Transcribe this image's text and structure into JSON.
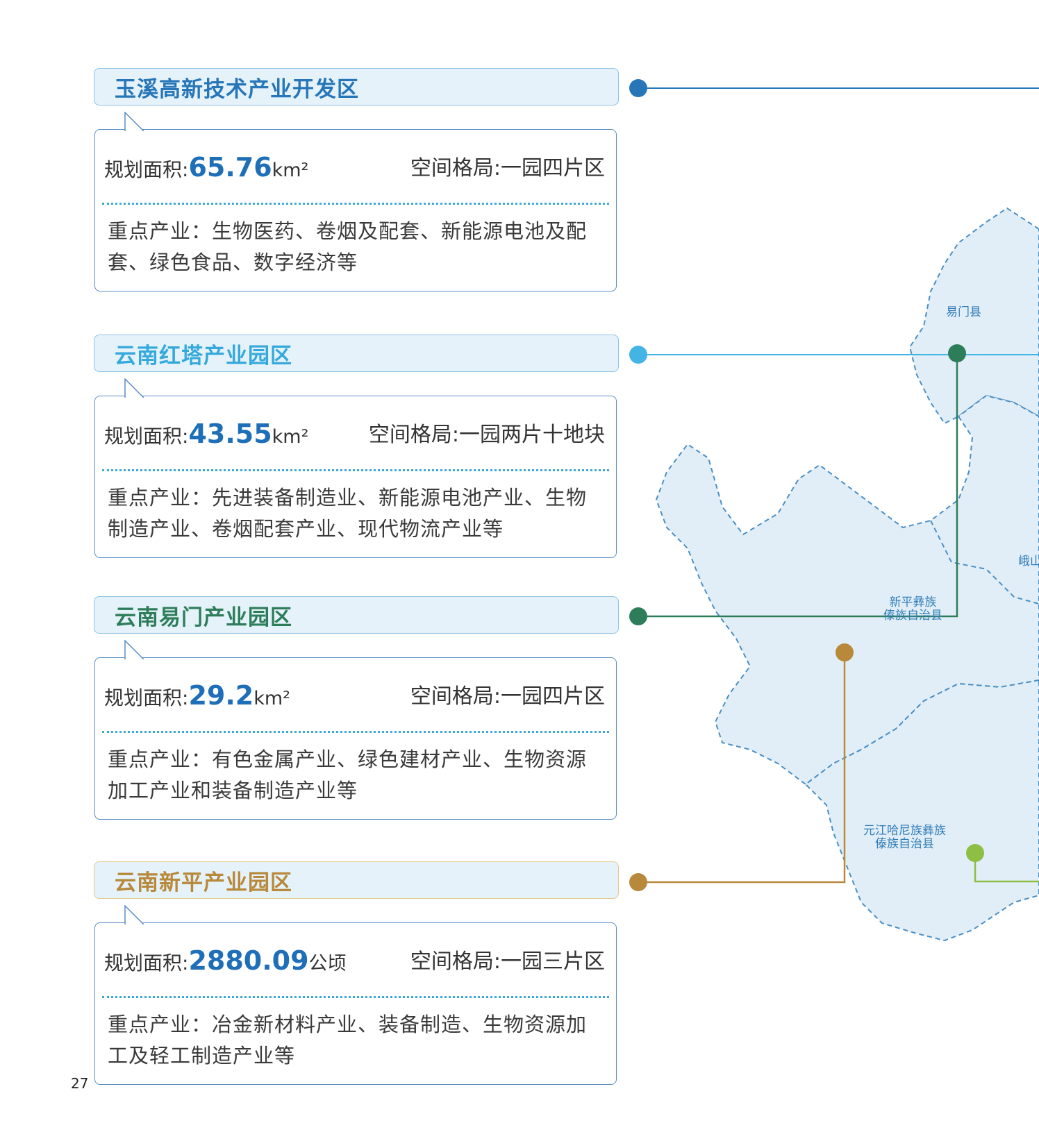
{
  "colors": {
    "blue_dark": "#2676b8",
    "blue_light": "#44b4e4",
    "green_dark": "#2e7d5a",
    "gold": "#b8893a",
    "green_light": "#8cbf44",
    "map_fill": "#e2eef7",
    "value_blue": "#1e6fb8"
  },
  "parks": [
    {
      "title": "玉溪高新技术产业开发区",
      "area_label": "规划面积:",
      "area_value": "65.76",
      "area_unit": "km²",
      "layout": "空间格局:一园四片区",
      "industries": "重点产业：生物医药、卷烟及配套、新能源电池及配套、绿色食品、数字经济等"
    },
    {
      "title": "云南红塔产业园区",
      "area_label": "规划面积:",
      "area_value": "43.55",
      "area_unit": "km²",
      "layout": "空间格局:一园两片十地块",
      "industries": "重点产业：先进装备制造业、新能源电池产业、生物制造产业、卷烟配套产业、现代物流产业等"
    },
    {
      "title": "云南易门产业园区",
      "area_label": "规划面积:",
      "area_value": "29.2",
      "area_unit": "km²",
      "layout": "空间格局:一园四片区",
      "industries": "重点产业：有色金属产业、绿色建材产业、生物资源加工产业和装备制造产业等"
    },
    {
      "title": "云南新平产业园区",
      "area_label": "规划面积:",
      "area_value": "2880.09",
      "area_unit": "公顷",
      "layout": "空间格局:一园三片区",
      "industries": "重点产业：冶金新材料产业、装备制造、生物资源加工及轻工制造产业等"
    }
  ],
  "map_labels": {
    "yimen": "易门县",
    "eshan": "峨山",
    "xinping_line1": "新平彝族",
    "xinping_line2": "傣族自治县",
    "yuanjiang_line1": "元江哈尼族彝族",
    "yuanjiang_line2": "傣族自治县"
  },
  "page_number": "27"
}
